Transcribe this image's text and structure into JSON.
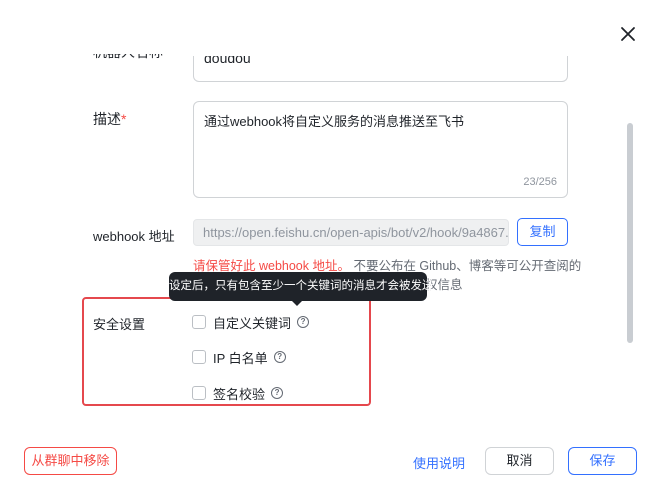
{
  "form": {
    "name_label": "机器人名称",
    "name_value": "doudou",
    "description_label": "描述",
    "required_mark": "*",
    "description_value": "通过webhook将自定义服务的消息推送至飞书",
    "description_count": "23/256",
    "webhook_label": "webhook 地址",
    "webhook_value": "https://open.feishu.cn/open-apis/bot/v2/hook/9a4867...",
    "copy_label": "复制",
    "warning_red": "请保管好此 webhook 地址。",
    "warning_rest": " 不要公布在 Github、博客等可公开查阅的",
    "warning_line2": "权信息"
  },
  "security": {
    "label": "安全设置",
    "tooltip": "设定后，只有包含至少一个关键词的消息才会被发送",
    "options": [
      {
        "label": "自定义关键词",
        "checked": false
      },
      {
        "label": "IP 白名单",
        "checked": false
      },
      {
        "label": "签名校验",
        "checked": false
      }
    ],
    "help_glyph": "?"
  },
  "footer": {
    "remove_label": "从群聊中移除",
    "help_label": "使用说明",
    "cancel_label": "取消",
    "save_label": "保存"
  },
  "icons": {
    "close": "close-icon",
    "help": "question-circle-icon"
  },
  "colors": {
    "accent": "#3370ff",
    "danger": "#f54a45",
    "highlight": "#e5484d",
    "tooltip_bg": "#1f2329"
  }
}
